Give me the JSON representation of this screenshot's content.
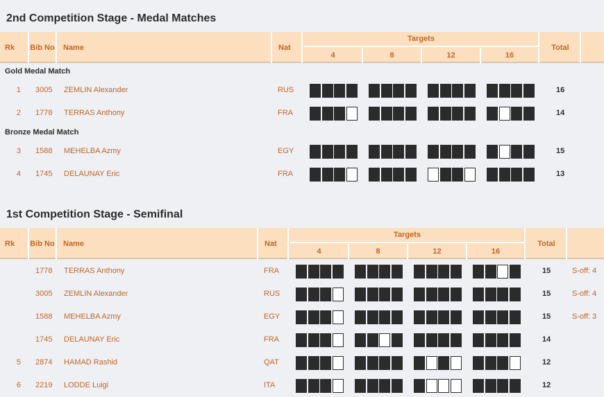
{
  "stage2": {
    "title": "2nd Competition Stage - Medal Matches",
    "headers": {
      "rk": "Rk",
      "bib": "Bib No",
      "name": "Name",
      "nat": "Nat",
      "targets": "Targets",
      "total": "Total",
      "t4": "4",
      "t8": "8",
      "t12": "12",
      "t16": "16"
    },
    "groups": [
      {
        "label": "Gold Medal Match",
        "rows": [
          {
            "rk": "1",
            "bib": "3005",
            "name": "ZEMLIN Alexander",
            "nat": "RUS",
            "shots": [
              1,
              1,
              1,
              1,
              1,
              1,
              1,
              1,
              1,
              1,
              1,
              1,
              1,
              1,
              1,
              1
            ],
            "total": "16",
            "soff": ""
          },
          {
            "rk": "2",
            "bib": "1778",
            "name": "TERRAS Anthony",
            "nat": "FRA",
            "shots": [
              1,
              1,
              1,
              0,
              1,
              1,
              1,
              1,
              1,
              1,
              1,
              1,
              1,
              0,
              1,
              1
            ],
            "total": "14",
            "soff": ""
          }
        ]
      },
      {
        "label": "Bronze Medal Match",
        "rows": [
          {
            "rk": "3",
            "bib": "1588",
            "name": "MEHELBA Azmy",
            "nat": "EGY",
            "shots": [
              1,
              1,
              1,
              1,
              1,
              1,
              1,
              1,
              1,
              1,
              1,
              1,
              1,
              0,
              1,
              1
            ],
            "total": "15",
            "soff": ""
          },
          {
            "rk": "4",
            "bib": "1745",
            "name": "DELAUNAY Eric",
            "nat": "FRA",
            "shots": [
              1,
              1,
              1,
              0,
              1,
              1,
              1,
              1,
              0,
              1,
              1,
              0,
              1,
              1,
              1,
              1
            ],
            "total": "13",
            "soff": ""
          }
        ]
      }
    ]
  },
  "stage1": {
    "title": "1st Competition Stage - Semifinal",
    "headers": {
      "rk": "Rk",
      "bib": "Bib No",
      "name": "Name",
      "nat": "Nat",
      "targets": "Targets",
      "total": "Total",
      "t4": "4",
      "t8": "8",
      "t12": "12",
      "t16": "16"
    },
    "rows": [
      {
        "rk": "",
        "bib": "1778",
        "name": "TERRAS Anthony",
        "nat": "FRA",
        "shots": [
          1,
          1,
          1,
          1,
          1,
          1,
          1,
          1,
          1,
          1,
          1,
          1,
          1,
          1,
          0,
          1
        ],
        "total": "15",
        "soff": "S-off: 4"
      },
      {
        "rk": "",
        "bib": "3005",
        "name": "ZEMLIN Alexander",
        "nat": "RUS",
        "shots": [
          1,
          1,
          1,
          0,
          1,
          1,
          1,
          1,
          1,
          1,
          1,
          1,
          1,
          1,
          1,
          1
        ],
        "total": "15",
        "soff": "S-off: 4"
      },
      {
        "rk": "",
        "bib": "1588",
        "name": "MEHELBA Azmy",
        "nat": "EGY",
        "shots": [
          1,
          1,
          1,
          0,
          1,
          1,
          1,
          1,
          1,
          1,
          1,
          1,
          1,
          1,
          1,
          1
        ],
        "total": "15",
        "soff": "S-off: 3"
      },
      {
        "rk": "",
        "bib": "1745",
        "name": "DELAUNAY Eric",
        "nat": "FRA",
        "shots": [
          1,
          1,
          1,
          0,
          1,
          1,
          0,
          1,
          1,
          1,
          1,
          1,
          1,
          1,
          1,
          1
        ],
        "total": "14",
        "soff": ""
      },
      {
        "rk": "5",
        "bib": "2874",
        "name": "HAMAD Rashid",
        "nat": "QAT",
        "shots": [
          1,
          1,
          1,
          0,
          1,
          1,
          1,
          1,
          1,
          0,
          1,
          0,
          1,
          1,
          1,
          0
        ],
        "total": "12",
        "soff": ""
      },
      {
        "rk": "6",
        "bib": "2219",
        "name": "LODDE Luigi",
        "nat": "ITA",
        "shots": [
          1,
          1,
          1,
          0,
          1,
          1,
          1,
          1,
          1,
          0,
          0,
          0,
          1,
          1,
          1,
          1
        ],
        "total": "12",
        "soff": ""
      }
    ]
  }
}
